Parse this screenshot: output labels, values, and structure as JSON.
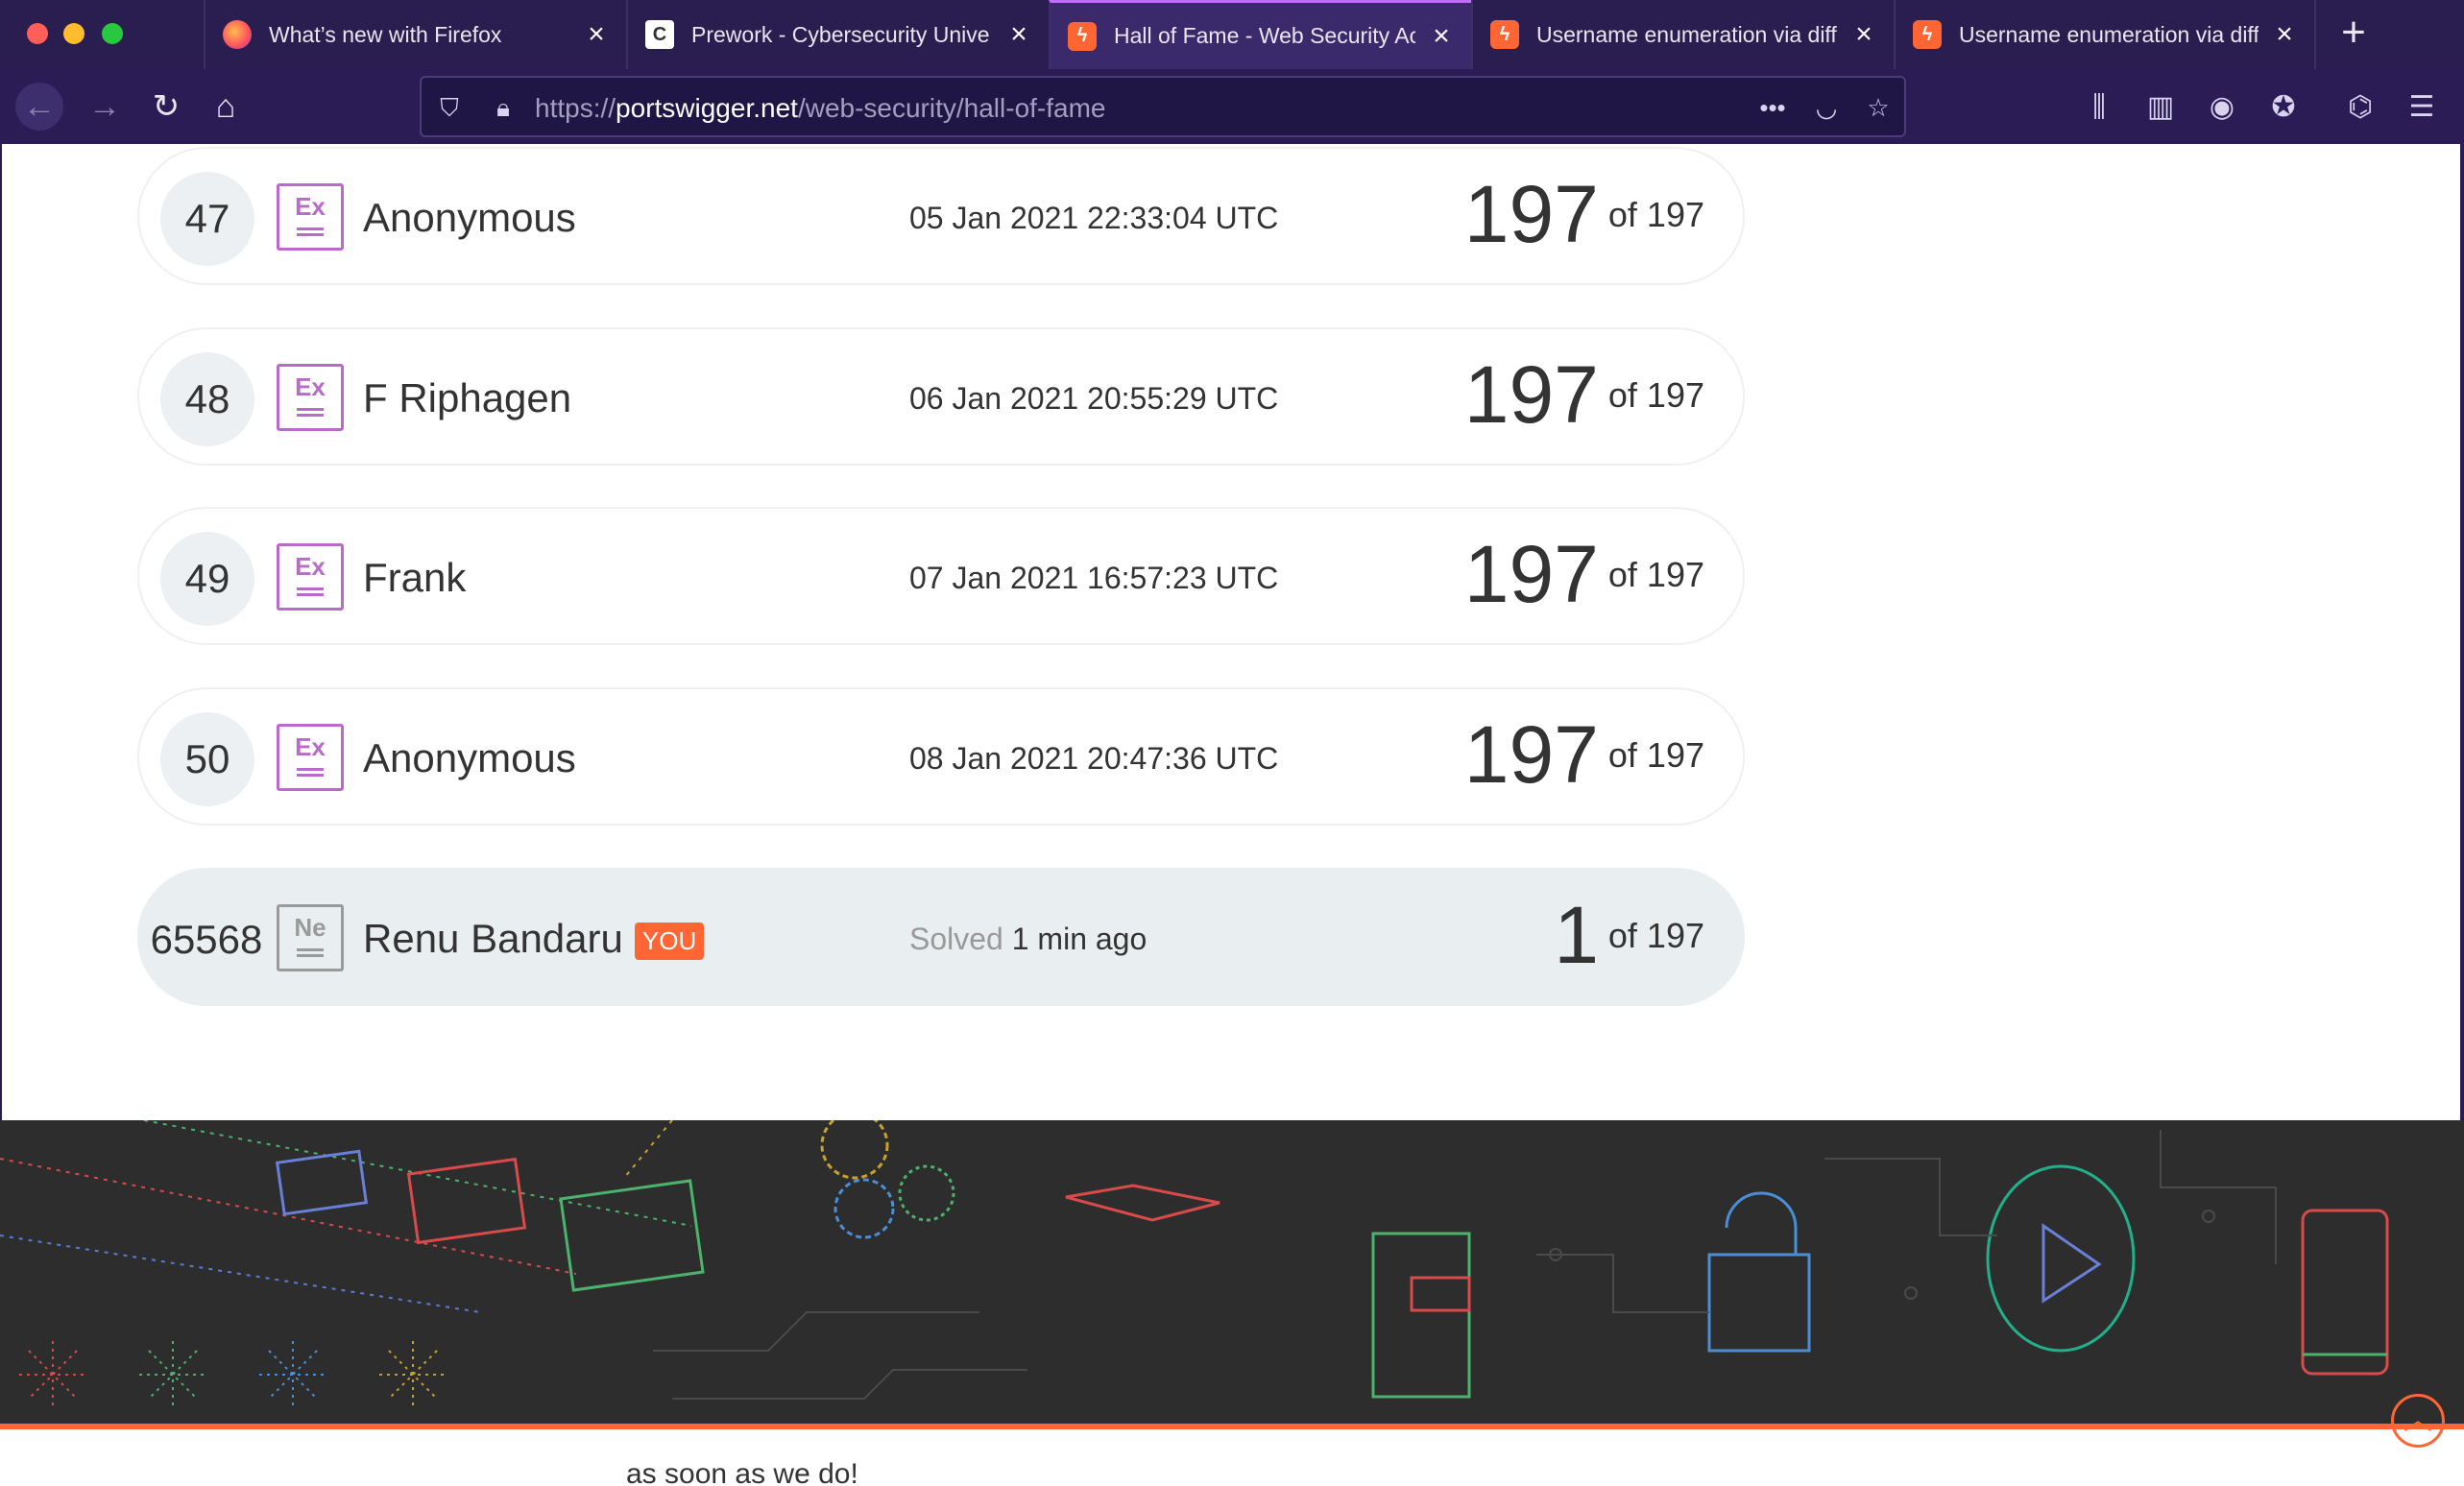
{
  "browser": {
    "tabs": [
      {
        "title": "What’s new with Firefox",
        "icon": "firefox-icon"
      },
      {
        "title": "Prework - Cybersecurity Unive",
        "icon": "prework-icon"
      },
      {
        "title": "Hall of Fame - Web Security Ac",
        "icon": "portswigger-icon",
        "active": true
      },
      {
        "title": "Username enumeration via diff",
        "icon": "portswigger-icon"
      },
      {
        "title": "Username enumeration via diff",
        "icon": "portswigger-icon"
      }
    ],
    "new_tab": "+",
    "url_prefix": "https://",
    "url_host": "portswigger.net",
    "url_path": "/web-security/hall-of-fame",
    "url_more": "•••"
  },
  "leaderboard": {
    "rows": [
      {
        "rank": "47",
        "badge": "Ex",
        "name": "Anonymous",
        "date": "05 Jan 2021 22:33:04 UTC",
        "score": "197",
        "total": "of 197"
      },
      {
        "rank": "48",
        "badge": "Ex",
        "name": "F Riphagen",
        "date": "06 Jan 2021 20:55:29 UTC",
        "score": "197",
        "total": "of 197"
      },
      {
        "rank": "49",
        "badge": "Ex",
        "name": "Frank",
        "date": "07 Jan 2021 16:57:23 UTC",
        "score": "197",
        "total": "of 197"
      },
      {
        "rank": "50",
        "badge": "Ex",
        "name": "Anonymous",
        "date": "08 Jan 2021 20:47:36 UTC",
        "score": "197",
        "total": "of 197"
      }
    ],
    "you": {
      "rank": "65568",
      "badge": "Ne",
      "name": "Renu Bandaru",
      "tag": "YOU",
      "solved_label": "Solved",
      "solved_time": "1 min ago",
      "score": "1",
      "total": "of 197"
    }
  },
  "footer": {
    "partial_text": "as soon as we do!",
    "accent": "#ff6633"
  }
}
